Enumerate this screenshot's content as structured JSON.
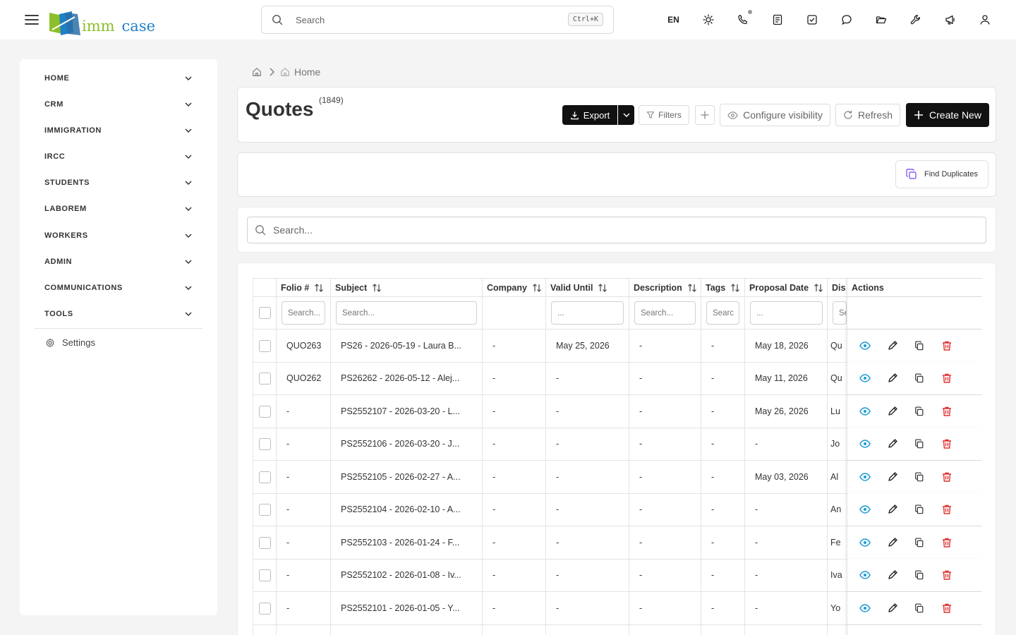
{
  "header": {
    "logo_word1": "imm",
    "logo_word2": "case",
    "search_placeholder": "Search",
    "search_shortcut": "Ctrl+K",
    "language": "EN"
  },
  "sidebar": {
    "items": [
      {
        "label": "HOME"
      },
      {
        "label": "CRM"
      },
      {
        "label": "IMMIGRATION"
      },
      {
        "label": "IRCC"
      },
      {
        "label": "STUDENTS"
      },
      {
        "label": "LABOREM"
      },
      {
        "label": "WORKERS"
      },
      {
        "label": "ADMIN"
      },
      {
        "label": "COMMUNICATIONS"
      },
      {
        "label": "TOOLS"
      }
    ],
    "settings_label": "Settings"
  },
  "breadcrumb": {
    "current": "Home"
  },
  "page": {
    "title": "Quotes",
    "count": "(1849)",
    "export_label": "Export",
    "filters_label": "Filters",
    "configure_label": "Configure visibility",
    "refresh_label": "Refresh",
    "create_label": "Create New",
    "find_duplicates_label": "Find Duplicates",
    "table_search_placeholder": "Search..."
  },
  "table": {
    "columns": [
      "Folio #",
      "Subject",
      "Company",
      "Valid Until",
      "Description",
      "Tags",
      "Proposal Date",
      "Dis",
      "Actions"
    ],
    "filter_placeholders": [
      "Search...",
      "Search...",
      "",
      "...",
      "Search...",
      "Searc",
      "...",
      "Se",
      ""
    ],
    "rows": [
      {
        "folio": "QUO263",
        "subject": "PS26 - 2026-05-19 - Laura B...",
        "company": "-",
        "valid_until": "May 25, 2026",
        "description": "-",
        "tags": "-",
        "proposal_date": "May 18, 2026",
        "dis": "Qu"
      },
      {
        "folio": "QUO262",
        "subject": "PS26262 - 2026-05-12 - Alej...",
        "company": "-",
        "valid_until": "-",
        "description": "-",
        "tags": "-",
        "proposal_date": "May 11, 2026",
        "dis": "Qu"
      },
      {
        "folio": "-",
        "subject": "PS2552107 - 2026-03-20 - L...",
        "company": "-",
        "valid_until": "-",
        "description": "-",
        "tags": "-",
        "proposal_date": "May 26, 2026",
        "dis": "Lu"
      },
      {
        "folio": "-",
        "subject": "PS2552106 - 2026-03-20 - J...",
        "company": "-",
        "valid_until": "-",
        "description": "-",
        "tags": "-",
        "proposal_date": "-",
        "dis": "Jo"
      },
      {
        "folio": "-",
        "subject": "PS2552105 - 2026-02-27 - A...",
        "company": "-",
        "valid_until": "-",
        "description": "-",
        "tags": "-",
        "proposal_date": "May 03, 2026",
        "dis": "Al"
      },
      {
        "folio": "-",
        "subject": "PS2552104 - 2026-02-10 - A...",
        "company": "-",
        "valid_until": "-",
        "description": "-",
        "tags": "-",
        "proposal_date": "-",
        "dis": "An"
      },
      {
        "folio": "-",
        "subject": "PS2552103 - 2026-01-24 - F...",
        "company": "-",
        "valid_until": "-",
        "description": "-",
        "tags": "-",
        "proposal_date": "-",
        "dis": "Fe"
      },
      {
        "folio": "-",
        "subject": "PS2552102 - 2026-01-08 - Iv...",
        "company": "-",
        "valid_until": "-",
        "description": "-",
        "tags": "-",
        "proposal_date": "-",
        "dis": "Iva"
      },
      {
        "folio": "-",
        "subject": "PS2552101 - 2026-01-05 - Y...",
        "company": "-",
        "valid_until": "-",
        "description": "-",
        "tags": "-",
        "proposal_date": "-",
        "dis": "Yo"
      }
    ]
  },
  "colors": {
    "view_icon": "#1a9bd7",
    "delete_icon": "#e03131",
    "duplicates_icon": "#8b5cf6",
    "primary_button": "#111111"
  }
}
